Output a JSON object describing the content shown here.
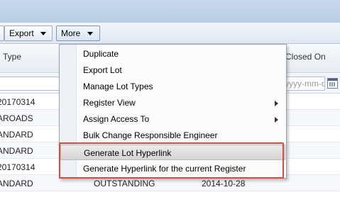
{
  "toolbar": {
    "export_label": "Export",
    "more_label": "More"
  },
  "grid": {
    "columns": {
      "type": "Type",
      "closed_on": "Closed On"
    },
    "date_placeholder": "yyyy-mm-dd",
    "rows": [
      {
        "c1": "20170314",
        "c2": "",
        "c3": ""
      },
      {
        "c1": "AROADS",
        "c2": "",
        "c3": ""
      },
      {
        "c1": "ANDARD",
        "c2": "",
        "c3": ""
      },
      {
        "c1": "ANDARD",
        "c2": "",
        "c3": ""
      },
      {
        "c1": "20170314",
        "c2": "",
        "c3": ""
      },
      {
        "c1": "ANDARD",
        "c2": "OUTSTANDING",
        "c3": "2014-10-28"
      }
    ]
  },
  "menu": {
    "items": [
      {
        "label": "Duplicate",
        "submenu": false
      },
      {
        "label": "Export Lot",
        "submenu": false
      },
      {
        "label": "Manage Lot Types",
        "submenu": false
      },
      {
        "label": "Register View",
        "submenu": true
      },
      {
        "label": "Assign Access To",
        "submenu": true
      },
      {
        "label": "Bulk Change Responsible Engineer",
        "submenu": false
      },
      {
        "label": "Generate Lot Hyperlink",
        "submenu": false
      },
      {
        "label": "Generate Hyperlink for the current Register",
        "submenu": false
      }
    ]
  },
  "colors": {
    "highlight_border": "#e0473f",
    "toolbar_bg": "#dfe7f1"
  }
}
